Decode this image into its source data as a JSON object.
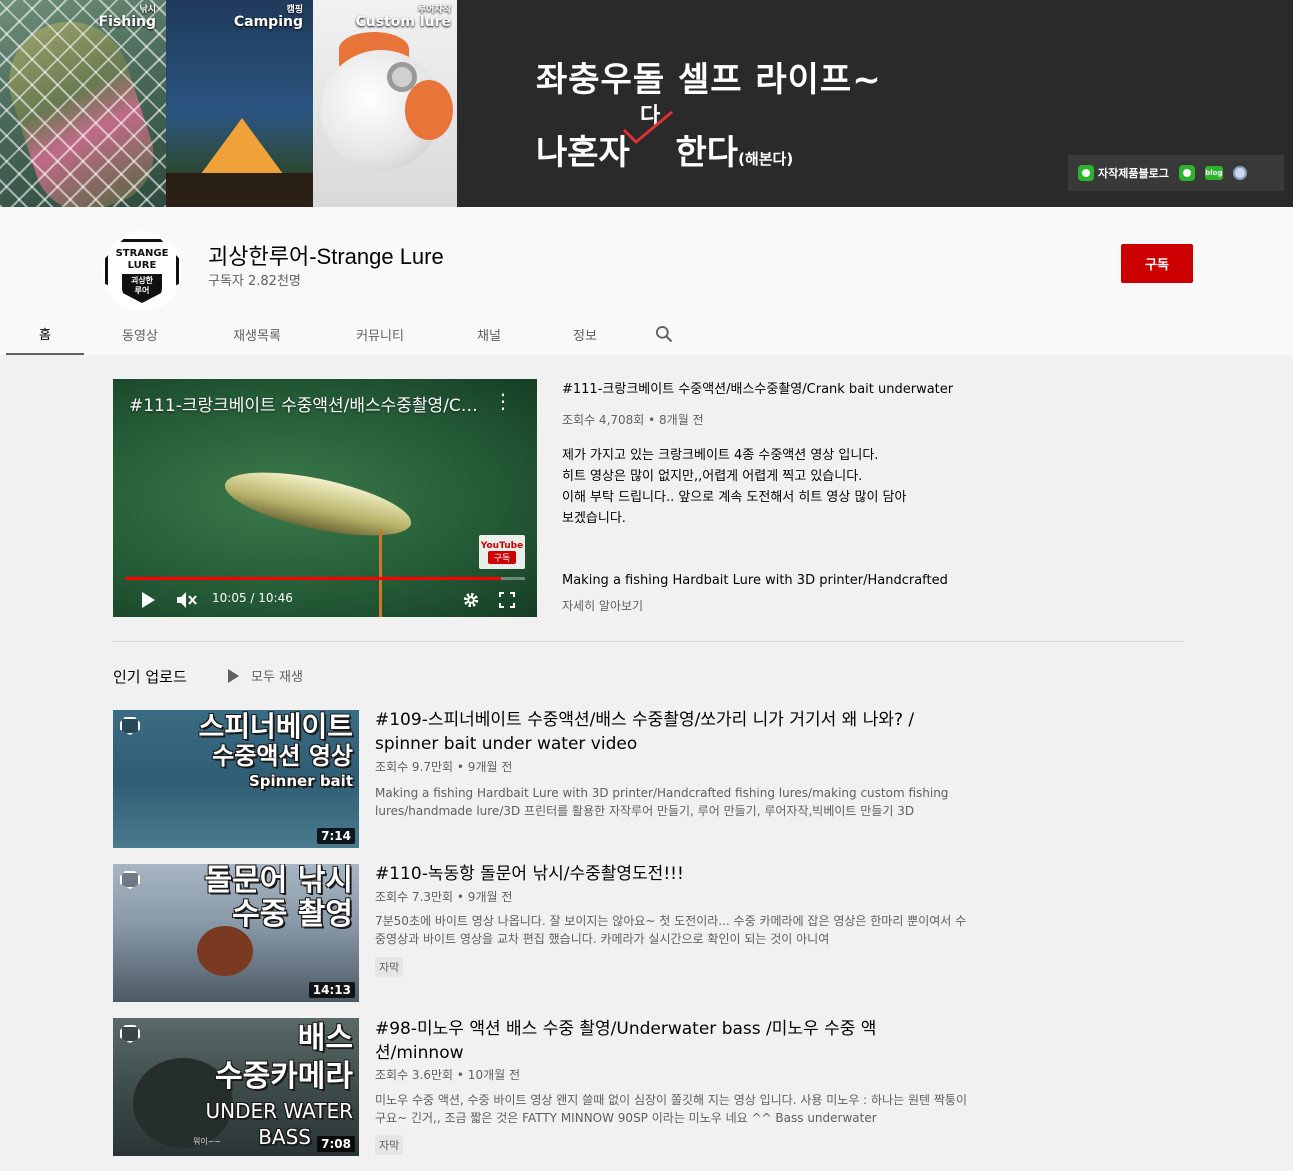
{
  "banner": {
    "panels": [
      {
        "small": "낚시",
        "label": "Fishing"
      },
      {
        "small": "캠핑",
        "label": "Camping"
      },
      {
        "small": "루어자작",
        "label": "Custom lure"
      }
    ],
    "headline1": "좌충우돌 셀프 라이프~",
    "headline2_a": "나혼자",
    "headline2_b": "한다",
    "headline2_small": "(해본다)",
    "headline_insert": "다",
    "links": [
      {
        "label": "자작제품블로그",
        "icon": "green-circle-icon"
      },
      {
        "label": "",
        "icon": "green-circle-icon"
      },
      {
        "label": "blog",
        "icon": "blog-icon"
      },
      {
        "label": "",
        "icon": "globe-icon"
      }
    ]
  },
  "channel": {
    "avatar_line1": "STRANGE",
    "avatar_line2": "LURE",
    "avatar_line3": "괴상한",
    "avatar_line4": "루어",
    "name": "괴상한루어-Strange Lure",
    "subscribers": "구독자 2.82천명",
    "subscribe_label": "구독"
  },
  "tabs": [
    {
      "label": "홈",
      "active": true
    },
    {
      "label": "동영상",
      "active": false
    },
    {
      "label": "재생목록",
      "active": false
    },
    {
      "label": "커뮤니티",
      "active": false
    },
    {
      "label": "채널",
      "active": false
    },
    {
      "label": "정보",
      "active": false
    }
  ],
  "featured": {
    "player_title": "#111-크랑크베이트 수중액션/배스수중촬영/Crank bait underwater",
    "badge_top": "YouTube",
    "badge_bottom": "구독",
    "time": "10:05 / 10:46",
    "progress": 0.94,
    "title": "#111-크랑크베이트 수중액션/배스수중촬영/Crank bait underwater",
    "meta": "조회수 4,708회 • 8개월 전",
    "desc_lines": [
      "제가 가지고 있는 크랑크베이트 4종 수중액션 영상 입니다.",
      "히트 영상은 많이 없지만,,어렵게 어렵게 찍고 있습니다.",
      "이해 부탁 드립니다..  앞으로 계속 도전해서 히트 영상 많이 담아",
      "보겠습니다."
    ],
    "desc_extra": "Making a fishing Hardbait Lure with 3D printer/Handcrafted",
    "more_label": "자세히 알아보기"
  },
  "popular": {
    "title": "인기 업로드",
    "play_all": "모두 재생",
    "videos": [
      {
        "thumb_lines": [
          "스피너베이트",
          "수중액션 영상",
          "Spinner bait"
        ],
        "duration": "7:14",
        "title": "#109-스피너베이트 수중액션/배스 수중촬영/쏘가리 니가 거기서 왜 나와? / spinner bait under water video",
        "meta": "조회수 9.7만회 • 9개월 전",
        "desc": "Making a fishing Hardbait Lure with 3D printer/Handcrafted fishing lures/making custom fishing lures/handmade lure/3D 프린터를 활용한 자작루어 만들기, 루어 만들기, 루어자작,빅베이트 만들기 3D",
        "cc": ""
      },
      {
        "thumb_lines": [
          "돌문어 낚시",
          "수중 촬영"
        ],
        "duration": "14:13",
        "title": "#110-녹동항 돌문어 낚시/수중촬영도전!!!",
        "meta": "조회수 7.3만회 • 9개월 전",
        "desc": "7분50초에 바이트 영상 나옵니다. 잘 보이지는 않아요~ 첫 도전이라... 수중 카메라에 잡은 영상은 한마리 뿐이여서 수중영상과 바이트 영상을 교차 편집 했습니다. 카메라가 실시간으로 확인이 되는 것이 아니여",
        "cc": "자막"
      },
      {
        "thumb_lines": [
          "배스",
          "수중카메라",
          "UNDER WATER",
          "BASS"
        ],
        "thumb_small": "워이~~",
        "duration": "7:08",
        "title": "#98-미노우 액션 배스 수중 촬영/Underwater bass /미노우 수중 액션/minnow",
        "meta": "조회수 3.6만회 • 10개월 전",
        "desc": "미노우 수중 액션, 수중 바이트 영상 왠지 쓸때 없이 심장이 쫄깃해 지는 영상 입니다. 사용 미노우 : 하나는 원텐 짝퉁이구요~ 긴거,, 조금 짧은 것은 FATTY MINNOW 90SP 이라는 미노우 네요 ^^ Bass underwater",
        "cc": "자막"
      }
    ]
  }
}
